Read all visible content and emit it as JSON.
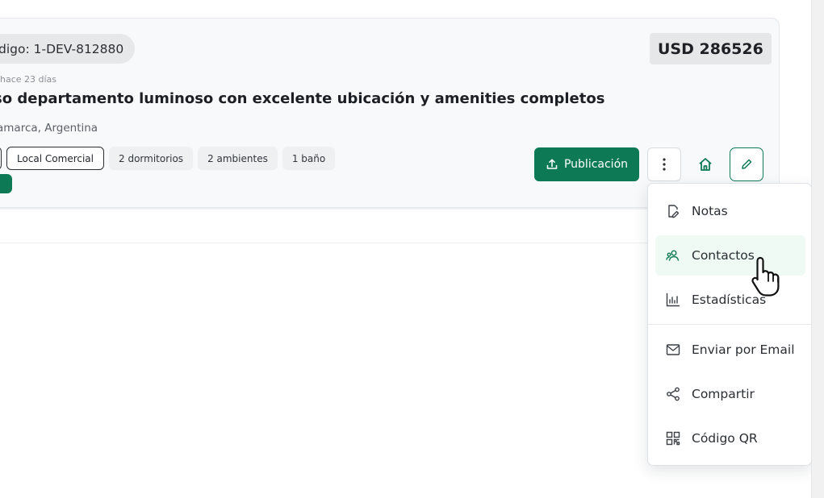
{
  "listing": {
    "code": "digo: 1-DEV-812880",
    "price": "USD 286526",
    "posted_ago": "hace 23 días",
    "title": "so departamento luminoso con excelente ubicación y amenities completos",
    "location": "amarca, Argentina",
    "tags": [
      "Local Comercial",
      "2 dormitorios",
      "2 ambientes",
      "1 baño"
    ]
  },
  "actions": {
    "publish_label": "Publicación",
    "more_icon": "vertical-dots-icon",
    "home_icon": "home-icon",
    "edit_icon": "pencil-icon"
  },
  "menu": {
    "items": [
      {
        "label": "Notas",
        "icon": "note-edit-icon"
      },
      {
        "label": "Contactos",
        "icon": "users-icon"
      },
      {
        "label": "Estadísticas",
        "icon": "bar-chart-icon"
      },
      {
        "label": "Enviar por Email",
        "icon": "mail-icon"
      },
      {
        "label": "Compartir",
        "icon": "share-icon"
      },
      {
        "label": "Código QR",
        "icon": "qr-code-icon"
      }
    ]
  },
  "colors": {
    "brand_green": "#0e7a55",
    "hover_bg": "#eefaf3",
    "card_bg": "#f8f9fb"
  }
}
